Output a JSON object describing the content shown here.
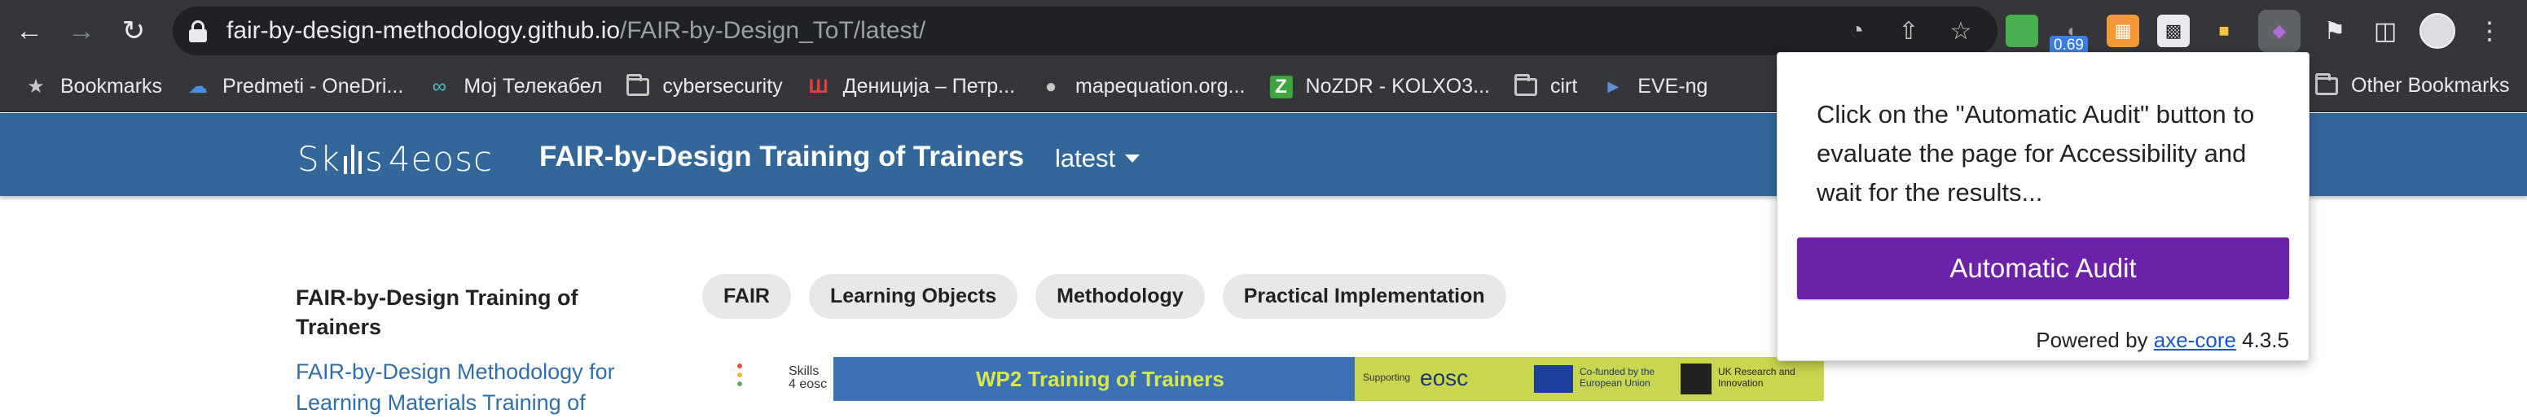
{
  "browser": {
    "url_host": "fair-by-design-methodology.github.io",
    "url_path": "/FAIR-by-Design_ToT/latest/",
    "extension_badge": "0.69",
    "bookmarks": [
      {
        "label": "Bookmarks",
        "icon": "star-icon"
      },
      {
        "label": "Predmeti - OneDri...",
        "icon": "cloud-icon"
      },
      {
        "label": "Мој Телекабел",
        "icon": "infinity-icon"
      },
      {
        "label": "cybersecurity",
        "icon": "folder-icon"
      },
      {
        "label": "Дениција – Петр...",
        "icon": "site-icon"
      },
      {
        "label": "mapequation.org...",
        "icon": "globe-icon"
      },
      {
        "label": "NoZDR - KOLXO3...",
        "icon": "z-icon"
      },
      {
        "label": "cirt",
        "icon": "folder-icon"
      },
      {
        "label": "EVE-ng",
        "icon": "eve-icon"
      }
    ],
    "other_bookmarks": "Other Bookmarks"
  },
  "site": {
    "logo_text_a": "Sk",
    "logo_text_b": "s",
    "logo_text_c": "4eosc",
    "title": "FAIR-by-Design Training of Trainers",
    "version": "latest",
    "header_color": "#336699"
  },
  "sidebar": {
    "title": "FAIR-by-Design Training of Trainers",
    "link": "FAIR-by-Design Methodology for Learning Materials Training of"
  },
  "tags": [
    "FAIR",
    "Learning Objects",
    "Methodology",
    "Practical Implementation"
  ],
  "banner": {
    "logo_line1": "Skills",
    "logo_line2": "4 eosc",
    "heading": "WP2 Training of Trainers",
    "supporting": "Supporting",
    "eosc": "eosc",
    "cofunded": "Co-funded by the European Union",
    "ukri": "UK Research and Innovation"
  },
  "popup": {
    "message": "Click on the \"Automatic Audit\" button to evaluate the page for Accessibility and wait for the results...",
    "button": "Automatic Audit",
    "powered_prefix": "Powered by ",
    "powered_link": "axe-core",
    "powered_version": " 4.3.5",
    "button_color": "#6b21a8"
  }
}
